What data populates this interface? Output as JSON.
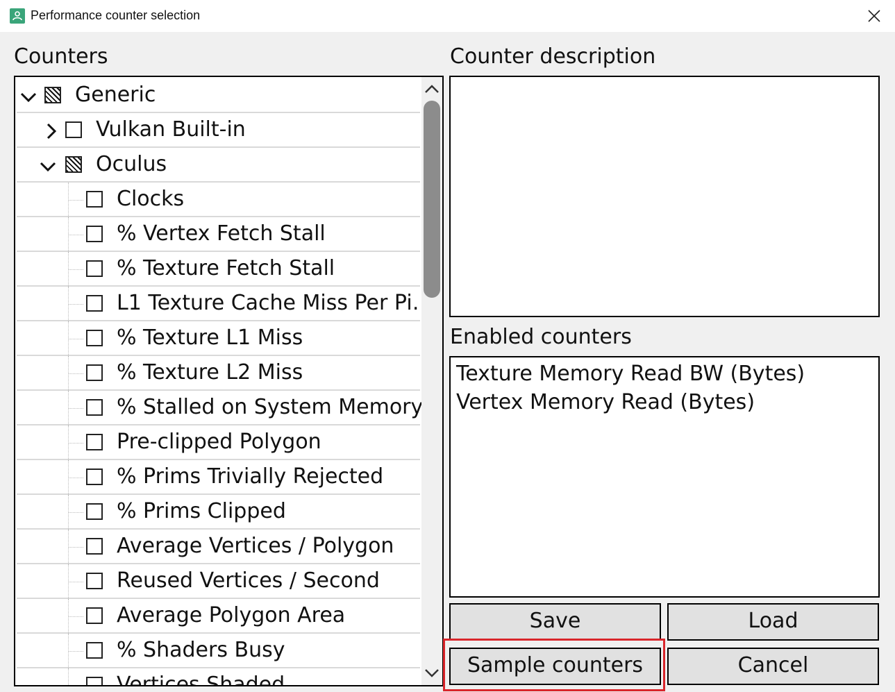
{
  "window": {
    "title": "Performance counter selection",
    "app_icon": "user-icon",
    "close_icon": "close-icon"
  },
  "counters_label": "Counters",
  "description_label": "Counter description",
  "description_text": "",
  "enabled_label": "Enabled counters",
  "enabled_counters": [
    "Texture Memory Read BW (Bytes)",
    "Vertex Memory Read (Bytes)"
  ],
  "tree": [
    {
      "label": "Generic",
      "expanded": true,
      "check": "partial"
    },
    {
      "label": "Vulkan Built-in",
      "expanded": false,
      "check": "unchecked"
    },
    {
      "label": "Oculus",
      "expanded": true,
      "check": "partial"
    },
    {
      "label": "Clocks",
      "check": "unchecked"
    },
    {
      "label": "% Vertex Fetch Stall",
      "check": "unchecked"
    },
    {
      "label": "% Texture Fetch Stall",
      "check": "unchecked"
    },
    {
      "label": "L1 Texture Cache Miss Per Pi…",
      "check": "unchecked"
    },
    {
      "label": "% Texture L1 Miss",
      "check": "unchecked"
    },
    {
      "label": "% Texture L2 Miss",
      "check": "unchecked"
    },
    {
      "label": "% Stalled on System Memory",
      "check": "unchecked"
    },
    {
      "label": "Pre-clipped Polygon",
      "check": "unchecked"
    },
    {
      "label": "% Prims Trivially Rejected",
      "check": "unchecked"
    },
    {
      "label": "% Prims Clipped",
      "check": "unchecked"
    },
    {
      "label": "Average Vertices / Polygon",
      "check": "unchecked"
    },
    {
      "label": "Reused Vertices / Second",
      "check": "unchecked"
    },
    {
      "label": "Average Polygon Area",
      "check": "unchecked"
    },
    {
      "label": "% Shaders Busy",
      "check": "unchecked"
    },
    {
      "label": "Vertices Shaded",
      "check": "unchecked"
    }
  ],
  "buttons": {
    "save": "Save",
    "load": "Load",
    "sample": "Sample counters",
    "cancel": "Cancel"
  },
  "highlight_color": "#d9262b"
}
